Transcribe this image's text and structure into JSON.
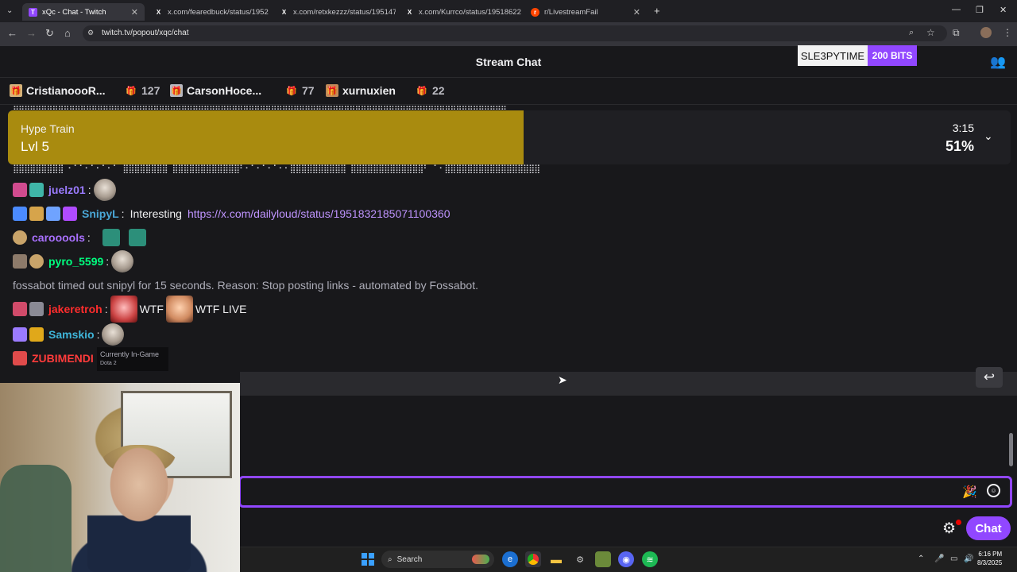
{
  "browser": {
    "tabs": [
      {
        "title": "xQc - Chat - Twitch",
        "favicon": "T",
        "color": "#9147ff"
      },
      {
        "title": "x.com/fearedbuck/status/1952",
        "favicon": "X",
        "color": "#000000"
      },
      {
        "title": "x.com/retxkezzz/status/195147",
        "favicon": "X",
        "color": "#000000"
      },
      {
        "title": "x.com/Kurrco/status/19518622",
        "favicon": "X",
        "color": "#000000"
      },
      {
        "title": "r/LivestreamFail",
        "favicon": "r",
        "color": "#ff4500"
      }
    ],
    "url": "twitch.tv/popout/xqc/chat"
  },
  "header": {
    "title": "Stream Chat",
    "bits_user": "SLE3PYTIME",
    "bits_amount": "200 BITS"
  },
  "leaderboard": {
    "entries": [
      {
        "name": "CristianoooR...",
        "count": ""
      },
      {
        "name": "",
        "count": "127"
      },
      {
        "name": "CarsonHoce...",
        "count": ""
      },
      {
        "name": "",
        "count": "77"
      },
      {
        "name": "xurnuxien",
        "count": ""
      },
      {
        "name": "",
        "count": "22"
      }
    ]
  },
  "hype_train": {
    "title": "Hype Train",
    "level": "Lvl 5",
    "time": "3:15",
    "percent_label": "51%",
    "progress": 0.51
  },
  "chat": {
    "messages": [
      {
        "user": "juelz01",
        "color": "#9b7bff",
        "text": ""
      },
      {
        "user": "SnipyL",
        "color": "#4aa7d6",
        "text": "Interesting",
        "link": "https://x.com/dailyloud/status/1951832185071100360"
      },
      {
        "user": "carooools",
        "color": "#a970ff",
        "text": ""
      },
      {
        "user": "pyro_5599",
        "color": "#00ff7f",
        "text": ""
      },
      {
        "system": "fossabot timed out snipyl for 15 seconds. Reason: Stop posting links - automated by Fossabot."
      },
      {
        "user": "jakeretroh",
        "color": "#ff2d2d",
        "text": "WTF",
        "text2": "WTF LIVE"
      },
      {
        "user": "Samskio",
        "color": "#3fb5d9",
        "text": ""
      },
      {
        "user": "ZUBIMENDI",
        "color": "#ff3b3b",
        "text": ""
      }
    ],
    "tooltip_title": "Currently In-Game",
    "tooltip_sub": "Dota 2"
  },
  "taskbar": {
    "search": "Search",
    "time": "6:16 PM",
    "date": "8/3/2025"
  },
  "footer": {
    "chat_button": "Chat"
  }
}
